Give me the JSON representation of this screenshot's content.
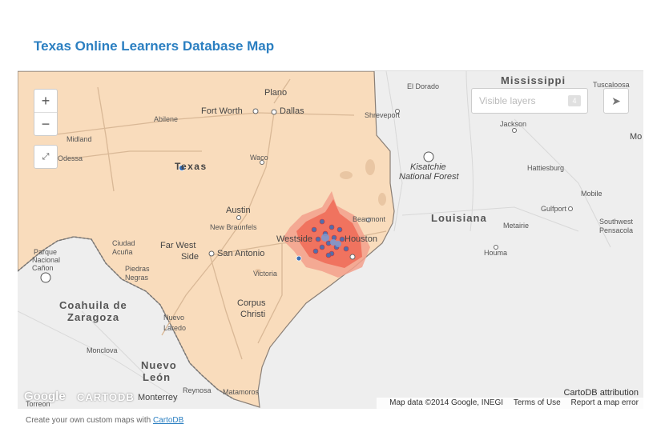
{
  "title": "Texas Online Learners Database Map",
  "map": {
    "zoom_in": "+",
    "zoom_out": "−",
    "visible_layers_label": "Visible layers",
    "visible_layers_count": "4",
    "attribution_label": "CartoDB attribution",
    "map_data": "Map data ©2014 Google, INEGI",
    "terms": "Terms of Use",
    "report": "Report a map error",
    "google_logo": "Google",
    "cartodb_logo": "CARTODB",
    "state_label": "Texas",
    "regions": [
      "Mississippi",
      "Louisiana",
      "Coahuila de",
      "Zaragoza",
      "Nuevo",
      "León"
    ],
    "cities": [
      "Plano",
      "Dallas",
      "Fort Worth",
      "Abilene",
      "Midland",
      "Odessa",
      "Waco",
      "Austin",
      "New Braunfels",
      "San Antonio",
      "Far West",
      "Side",
      "Westside",
      "Houston",
      "Beaumont",
      "Shreveport",
      "El Dorado",
      "Jackson",
      "Hattiesburg",
      "Mobile",
      "Gulfport",
      "Metairie",
      "Houma",
      "Victoria",
      "Corpus",
      "Christi",
      "Nuevo",
      "Laredo",
      "Monclova",
      "Reynosa",
      "Matamoros",
      "Monterrey",
      "Ciudad",
      "Acuña",
      "Piedras",
      "Negras",
      "Torreon",
      "Tuscaloosa",
      "Mo",
      "Kisatchie",
      "National Forest",
      "Southwest",
      "Pensacola",
      "Parque",
      "Nacional",
      "Cañon"
    ],
    "colors": {
      "texas_fill": "#f9dcbc",
      "hotspot": "#ef6d5a",
      "points": "#3a6fb5"
    }
  },
  "footer": {
    "text": "Create your own custom maps with",
    "link": "CartoDB"
  }
}
